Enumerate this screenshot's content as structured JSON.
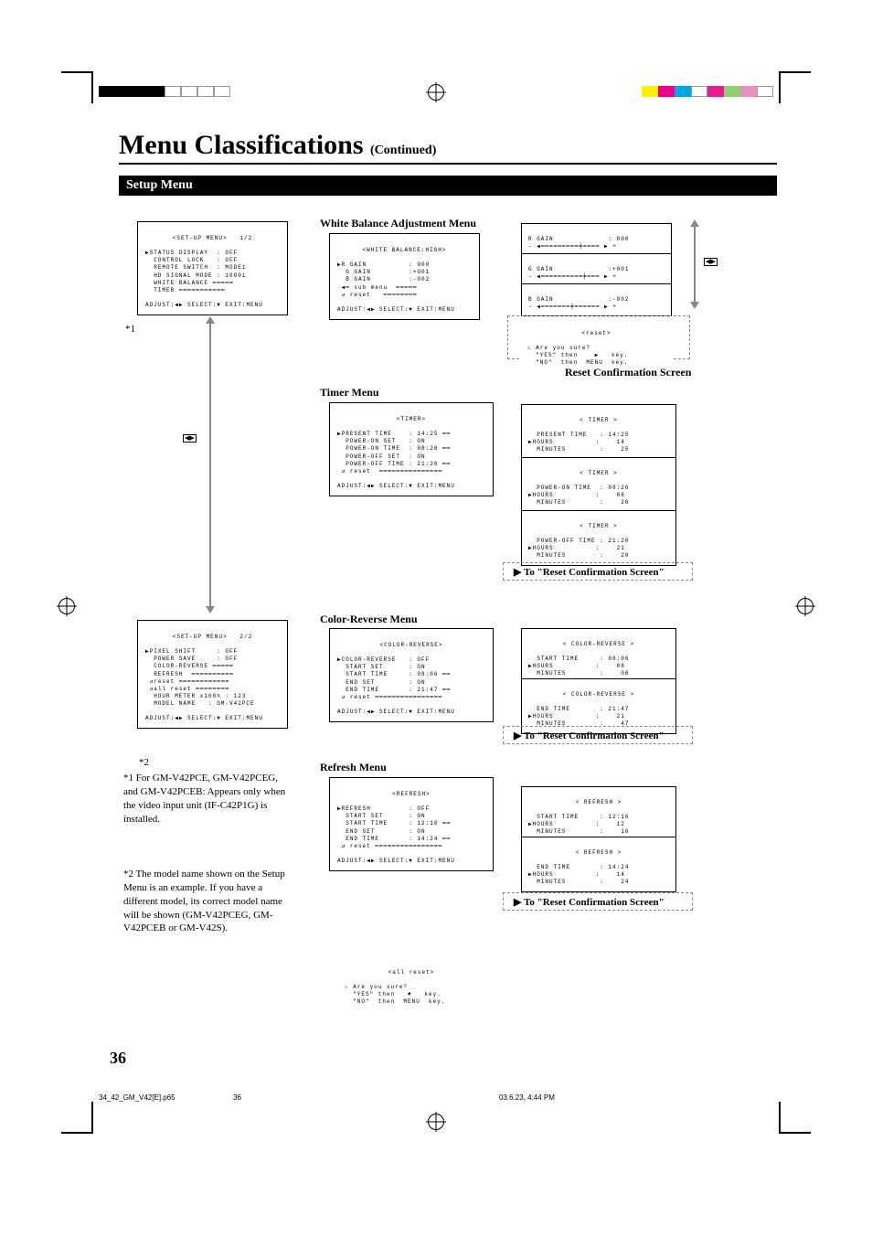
{
  "page": {
    "title": "Menu Classifications",
    "continued": "(Continued)",
    "section": "Setup Menu",
    "page_number": "36"
  },
  "footer": {
    "file": "34_42_GM_V42[E].p65",
    "slug_page": "36",
    "timestamp": "03.6.23, 4:44 PM"
  },
  "color_bar_left": [
    "#000000",
    "#000000",
    "#000000",
    "#000000",
    "#ffffff",
    "#ffffff",
    "#ffffff",
    "#ffffff"
  ],
  "color_bar_right": [
    "#fff000",
    "#ee008f",
    "#00a7e0",
    "#ffffff",
    "#ea1b8f",
    "#8fd170",
    "#e890c3",
    "#ffffff"
  ],
  "setup_menu_1": {
    "header": "<SET-UP MENU>   1/2",
    "lines": [
      "▶STATUS DISPLAY  : OFF",
      "  CONTROL LOCK   : OFF",
      "  REMOTE SWITCH  : MODE1",
      "  HD SIGNAL MODE : 1080i",
      "  WHITE BALANCE ━━━━━",
      "  TIMER ━━━━━━━━━━━"
    ],
    "foot": "ADJUST:◀▶ SELECT:▼ EXIT:MENU"
  },
  "wb_head": "White Balance Adjustment Menu",
  "wb_menu": {
    "header": "<WHITE BALANCE:HIGH>",
    "lines": [
      "▶R GAIN          : 000",
      "  G GAIN         :+001",
      "  B GAIN         :-002",
      " ◀━ sub menu  ━━━━━",
      " ↺ reset   ━━━━━━━━"
    ],
    "foot": "ADJUST:◀▶ SELECT:▼ EXIT:MENU"
  },
  "wb_sliders": [
    {
      "label": "R GAIN",
      "value": ": 000"
    },
    {
      "label": "G GAIN",
      "value": ":+001"
    },
    {
      "label": "B GAIN",
      "value": ":-002"
    }
  ],
  "reset_confirm": {
    "header": "<reset>",
    "line1": "⚠ Are you sure?",
    "line2": "  \"YES\" then    ▶   key.",
    "line3": "  \"NO\"  then  MENU  key."
  },
  "reset_confirm_label": "Reset Confirmation Screen",
  "timer_head": "Timer Menu",
  "timer_menu": {
    "header": "<TIMER>",
    "lines": [
      "▶PRESENT TIME    : 14:25 ━━",
      "  POWER-ON SET   : ON",
      "  POWER-ON TIME  : 08:26 ━━",
      "  POWER-OFF SET  : ON",
      "  POWER-OFF TIME : 21:20 ━━",
      " ↺ reset  ━━━━━━━━━━━━━━━"
    ],
    "foot": "ADJUST:◀▶ SELECT:▼ EXIT:MENU"
  },
  "timer_subs": [
    {
      "header": "< TIMER >",
      "l1": "  PRESENT TIME   : 14:25",
      "l2": "▶HOURS          :    14",
      "l3": "  MINUTES        :    25"
    },
    {
      "header": "< TIMER >",
      "l1": "  POWER-ON TIME  : 08:26",
      "l2": "▶HOURS          :    08",
      "l3": "  MINUTES        :    26"
    },
    {
      "header": "< TIMER >",
      "l1": "  POWER-OFF TIME : 21:20",
      "l2": "▶HOURS          :    21",
      "l3": "  MINUTES        :    20"
    }
  ],
  "to_reset": "To \"Reset Confirmation Screen\"",
  "setup_menu_2": {
    "header": "<SET-UP MENU>   2/2",
    "lines": [
      "▶PIXEL SHIFT     : OFF",
      "  POWER SAVE     : OFF",
      "  COLOR-REVERSE ━━━━━",
      "  REFRESH  ━━━━━━━━━━",
      " ↺reset ━━━━━━━━━━━━",
      " ↺all reset ━━━━━━━━",
      "  HOUR METER x100h : 123",
      "  MODEL NAME   : GM-V42PCE"
    ],
    "foot": "ADJUST:◀▶ SELECT:▼ EXIT:MENU"
  },
  "cr_head": "Color-Reverse Menu",
  "cr_menu": {
    "header": "<COLOR-REVERSE>",
    "lines": [
      "▶COLOR-REVERSE   : OFF",
      "  START SET      : ON",
      "  START TIME     : 08:06 ━━",
      "  END SET        : ON",
      "  END TIME       : 21:47 ━━",
      " ↺ reset ━━━━━━━━━━━━━━━━"
    ],
    "foot": "ADJUST:◀▶ SELECT:▼ EXIT:MENU"
  },
  "cr_subs": [
    {
      "header": "< COLOR-REVERSE >",
      "l1": "  START TIME     : 08:06",
      "l2": "▶HOURS          :    08",
      "l3": "  MINUTES        :    06"
    },
    {
      "header": "< COLOR-REVERSE >",
      "l1": "  END TIME       : 21:47",
      "l2": "▶HOURS          :    21",
      "l3": "  MINUTES        :    47"
    }
  ],
  "refresh_head": "Refresh Menu",
  "refresh_menu": {
    "header": "<REFRESH>",
    "lines": [
      "▶REFRESH         : OFF",
      "  START SET      : ON",
      "  START TIME     : 12:10 ━━",
      "  END SET        : ON",
      "  END TIME       : 14:24 ━━",
      " ↺ reset ━━━━━━━━━━━━━━━━"
    ],
    "foot": "ADJUST:◀▶ SELECT:▼ EXIT:MENU"
  },
  "refresh_subs": [
    {
      "header": "< REFRESH >",
      "l1": "  START TIME     : 12:10",
      "l2": "▶HOURS          :    12",
      "l3": "  MINUTES        :    10"
    },
    {
      "header": "< REFRESH >",
      "l1": "  END TIME       : 14:24",
      "l2": "▶HOURS          :    14",
      "l3": "  MINUTES        :    24"
    }
  ],
  "all_reset": {
    "header": "<all reset>",
    "line1": "⚠ Are you sure?",
    "line2": "  \"YES\" then   ▼   key.",
    "line3": "  \"NO\"  then  MENU  key."
  },
  "footnotes": {
    "ref1": "*1",
    "ref2": "*2",
    "note1": "*1 For GM-V42PCE, GM-V42PCEG, and GM-V42PCEB: Appears only when the video input unit (IF-C42P1G) is installed.",
    "note2": "*2 The model name shown on the Setup Menu is an example. If you have a different model, its correct model name will be shown (GM-V42PCEG, GM-V42PCEB or GM-V42S)."
  }
}
